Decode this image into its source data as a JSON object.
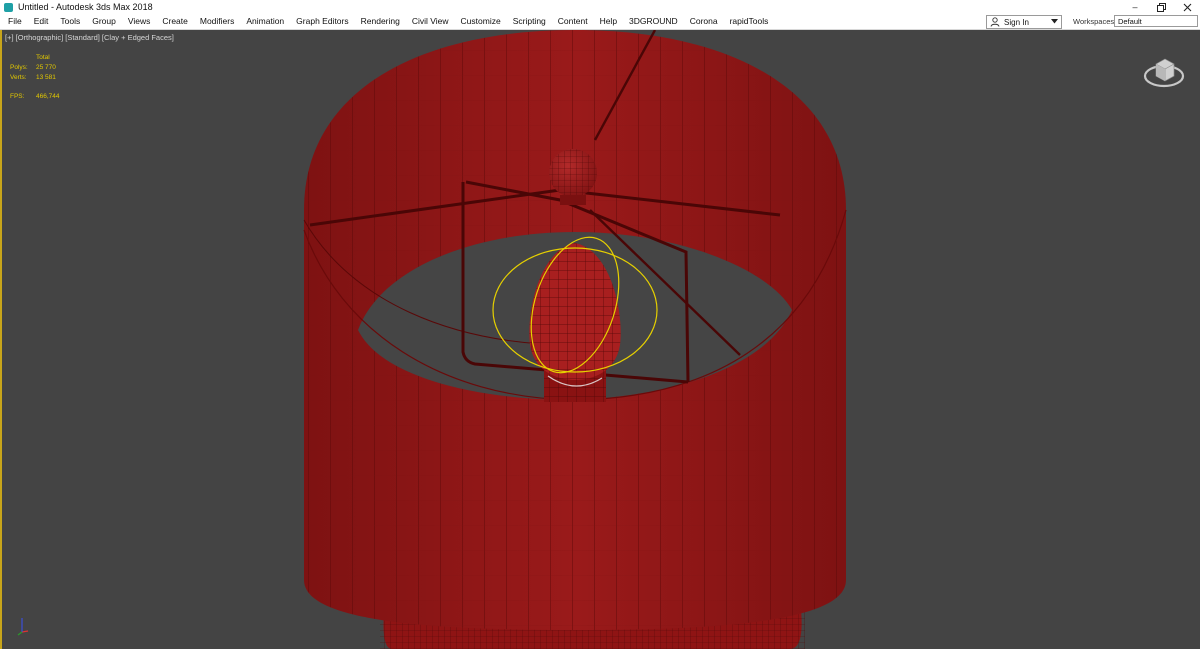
{
  "window": {
    "title": "Untitled - Autodesk 3ds Max 2018",
    "minimize": "–"
  },
  "menu": [
    "File",
    "Edit",
    "Tools",
    "Group",
    "Views",
    "Create",
    "Modifiers",
    "Animation",
    "Graph Editors",
    "Rendering",
    "Civil View",
    "Customize",
    "Scripting",
    "Content",
    "Help",
    "3DGROUND",
    "Corona",
    "rapidTools"
  ],
  "account": {
    "sign_in": "Sign In"
  },
  "workspaces": {
    "label": "Workspaces:",
    "value": "Default"
  },
  "viewport": {
    "label": "[+] [Orthographic] [Standard] [Clay + Edged Faces]",
    "stats": {
      "total_label": "Total",
      "polys_label": "Polys:",
      "polys_value": "25 770",
      "verts_label": "Verts:",
      "verts_value": "13 581",
      "fps_label": "FPS:",
      "fps_value": "466,744"
    }
  },
  "colors": {
    "viewport_bg": "#444444",
    "model_red": "#8f1414",
    "wire": "#4f0707",
    "selection": "#e6d000",
    "stats_text": "#e2c800"
  },
  "icons": {
    "app": "3dsmax-icon",
    "account": "person-icon",
    "navigation": "viewcube-icon",
    "axis": "axis-tripod-icon"
  }
}
